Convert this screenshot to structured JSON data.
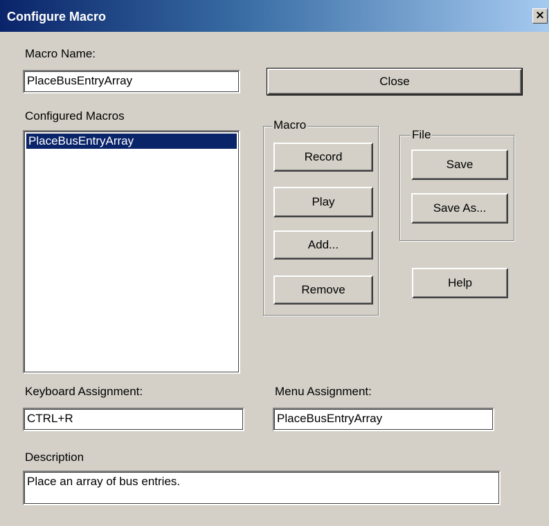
{
  "window": {
    "title": "Configure Macro",
    "close_glyph": "×"
  },
  "macro_name": {
    "label": "Macro Name:",
    "value": "PlaceBusEntryArray"
  },
  "close_button": {
    "label": "Close"
  },
  "configured_macros": {
    "label": "Configured Macros",
    "items": [
      "PlaceBusEntryArray"
    ]
  },
  "macro_group": {
    "title": "Macro",
    "buttons": {
      "record": "Record",
      "play": "Play",
      "add": "Add...",
      "remove": "Remove"
    }
  },
  "file_group": {
    "title": "File",
    "buttons": {
      "save": "Save",
      "save_as": "Save As..."
    }
  },
  "help_button": {
    "label": "Help"
  },
  "keyboard_assignment": {
    "label": "Keyboard Assignment:",
    "value": "CTRL+R"
  },
  "menu_assignment": {
    "label": "Menu Assignment:",
    "value": "PlaceBusEntryArray"
  },
  "description": {
    "label": "Description",
    "value": "Place an array of bus entries."
  },
  "colors": {
    "title_bar": "#0a246a",
    "selection": "#0a246a",
    "dialog_bg": "#d4d0c8"
  }
}
